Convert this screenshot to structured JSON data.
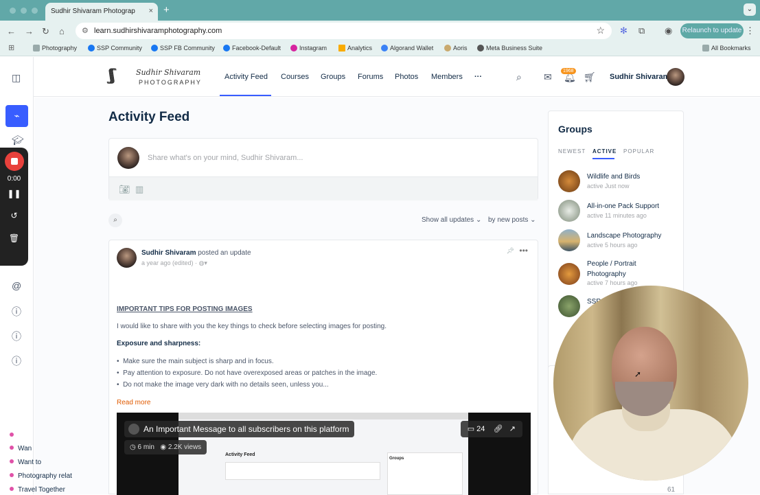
{
  "browser": {
    "tab_title": "Sudhir Shivaram Photograp",
    "tab_close": "×",
    "new_tab": "+",
    "url": "learn.sudhirshivaramphotography.com",
    "relaunch_label": "Relaunch to update",
    "bookmarks": [
      {
        "label": "Photography",
        "color": "#9aa"
      },
      {
        "label": "SSP Community",
        "color": "#1877f2"
      },
      {
        "label": "SSP FB Community",
        "color": "#1877f2"
      },
      {
        "label": "Facebook-Default",
        "color": "#1877f2"
      },
      {
        "label": "Instagram",
        "color": "#d6249f"
      },
      {
        "label": "Analytics",
        "color": "#f9ab00"
      },
      {
        "label": "Algorand Wallet",
        "color": "#3b82f6"
      },
      {
        "label": "Aoris",
        "color": "#c9a96e"
      },
      {
        "label": "Meta Business Suite",
        "color": "#555"
      }
    ],
    "all_bookmarks": "All Bookmarks"
  },
  "recorder": {
    "time": "0:00"
  },
  "header": {
    "logo_line1": "Sudhir Shivaram",
    "logo_line2": "PHOTOGRAPHY",
    "menu": [
      "Activity Feed",
      "Courses",
      "Groups",
      "Forums",
      "Photos",
      "Members"
    ],
    "more": "···",
    "notification_count": "1968",
    "user_name": "Sudhir Shivaram"
  },
  "main": {
    "title": "Activity Feed",
    "composer_placeholder": "Share what's on your mind, Sudhir Shivaram...",
    "filter_updates": "Show all updates ⌄",
    "filter_sort": "by new posts ⌄"
  },
  "post": {
    "author": "Sudhir Shivaram",
    "action": " posted an update",
    "meta": "a year ago (edited)  ·",
    "heading": "IMPORTANT TIPS FOR POSTING IMAGES",
    "intro": "I would like to share with you the key things to check before selecting images for posting.",
    "subheading": "Exposure and sharpness:",
    "bullets": [
      "Make sure the main subject is sharp and in focus.",
      "Pay attention to exposure. Do not have overexposed areas or patches in the image.",
      "Do not make the image very dark with no details seen, unless you..."
    ],
    "read_more": "Read more",
    "video": {
      "title": "An Important Message to all subscribers on this platform",
      "duration": "6 min",
      "views": "2.2K views",
      "comments": "24",
      "inner_title": "Activity Feed",
      "inner_groups": "Groups"
    }
  },
  "groups": {
    "title": "Groups",
    "tabs": [
      "NEWEST",
      "ACTIVE",
      "POPULAR"
    ],
    "items": [
      {
        "name": "Wildlife and Birds",
        "active": "active Just now",
        "color": "#b86b2a"
      },
      {
        "name": "All-in-one Pack Support",
        "active": "active 11 minutes ago",
        "color": "#a9b3a8"
      },
      {
        "name": "Landscape Photography",
        "active": "active 5 hours ago",
        "color": "#6d8a9a"
      },
      {
        "name": "People / Portrait Photography",
        "active": "active 7 hours ago",
        "color": "#d9892e"
      },
      {
        "name": "SSP",
        "active": "",
        "color": "#5f7a4c"
      }
    ]
  },
  "forums": {
    "items": [
      "Wan",
      "Want to",
      "Photography relat",
      "Travel Together"
    ],
    "last_count": "61"
  }
}
